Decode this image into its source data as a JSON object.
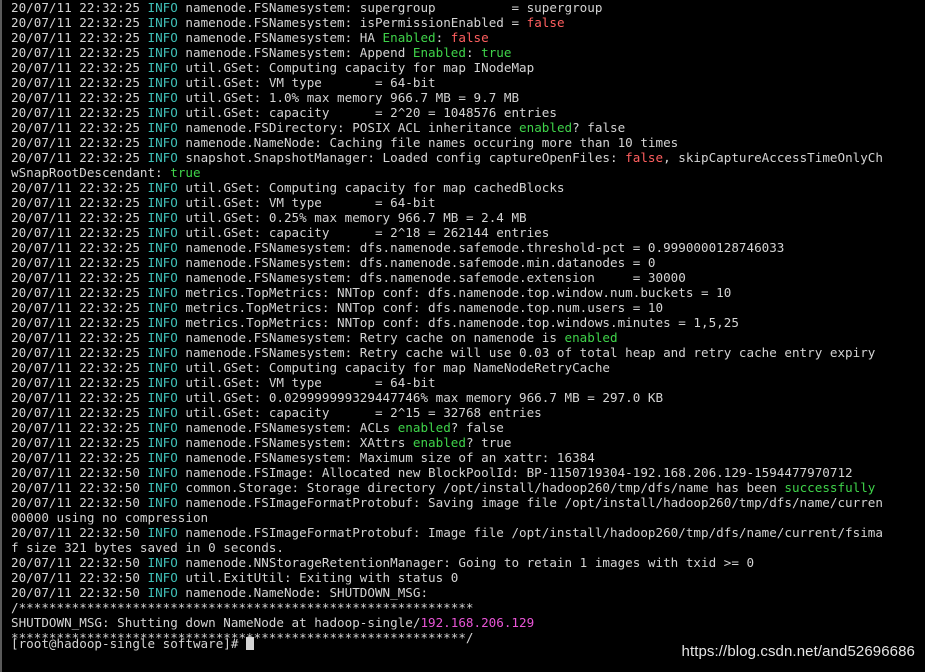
{
  "terminal": {
    "lines": [
      [
        {
          "t": "20/07/11 22:32:25 ",
          "c": "ts"
        },
        {
          "t": "INFO",
          "c": "info"
        },
        {
          "t": " namenode.FSNamesystem: supergroup          = supergroup",
          "c": "ts"
        }
      ],
      [
        {
          "t": "20/07/11 22:32:25 ",
          "c": "ts"
        },
        {
          "t": "INFO",
          "c": "info"
        },
        {
          "t": " namenode.FSNamesystem: isPermissionEnabled = ",
          "c": "ts"
        },
        {
          "t": "false",
          "c": "hl-red"
        }
      ],
      [
        {
          "t": "20/07/11 22:32:25 ",
          "c": "ts"
        },
        {
          "t": "INFO",
          "c": "info"
        },
        {
          "t": " namenode.FSNamesystem: HA ",
          "c": "ts"
        },
        {
          "t": "Enabled",
          "c": "hl-green"
        },
        {
          "t": ": ",
          "c": "ts"
        },
        {
          "t": "false",
          "c": "hl-red"
        }
      ],
      [
        {
          "t": "20/07/11 22:32:25 ",
          "c": "ts"
        },
        {
          "t": "INFO",
          "c": "info"
        },
        {
          "t": " namenode.FSNamesystem: Append ",
          "c": "ts"
        },
        {
          "t": "Enabled",
          "c": "hl-green"
        },
        {
          "t": ": ",
          "c": "ts"
        },
        {
          "t": "true",
          "c": "hl-green"
        }
      ],
      [
        {
          "t": "20/07/11 22:32:25 ",
          "c": "ts"
        },
        {
          "t": "INFO",
          "c": "info"
        },
        {
          "t": " util.GSet: Computing capacity for map INodeMap",
          "c": "ts"
        }
      ],
      [
        {
          "t": "20/07/11 22:32:25 ",
          "c": "ts"
        },
        {
          "t": "INFO",
          "c": "info"
        },
        {
          "t": " util.GSet: VM type       = 64-bit",
          "c": "ts"
        }
      ],
      [
        {
          "t": "20/07/11 22:32:25 ",
          "c": "ts"
        },
        {
          "t": "INFO",
          "c": "info"
        },
        {
          "t": " util.GSet: 1.0% max memory 966.7 MB = 9.7 MB",
          "c": "ts"
        }
      ],
      [
        {
          "t": "20/07/11 22:32:25 ",
          "c": "ts"
        },
        {
          "t": "INFO",
          "c": "info"
        },
        {
          "t": " util.GSet: capacity      = 2^20 = 1048576 entries",
          "c": "ts"
        }
      ],
      [
        {
          "t": "20/07/11 22:32:25 ",
          "c": "ts"
        },
        {
          "t": "INFO",
          "c": "info"
        },
        {
          "t": " namenode.FSDirectory: POSIX ACL inheritance ",
          "c": "ts"
        },
        {
          "t": "enabled",
          "c": "hl-green"
        },
        {
          "t": "? false",
          "c": "ts"
        }
      ],
      [
        {
          "t": "20/07/11 22:32:25 ",
          "c": "ts"
        },
        {
          "t": "INFO",
          "c": "info"
        },
        {
          "t": " namenode.NameNode: Caching file names occuring more than 10 times",
          "c": "ts"
        }
      ],
      [
        {
          "t": "20/07/11 22:32:25 ",
          "c": "ts"
        },
        {
          "t": "INFO",
          "c": "info"
        },
        {
          "t": " snapshot.SnapshotManager: Loaded config captureOpenFiles: ",
          "c": "ts"
        },
        {
          "t": "false",
          "c": "hl-red"
        },
        {
          "t": ", skipCaptureAccessTimeOnlyCh",
          "c": "ts"
        }
      ],
      [
        {
          "t": "wSnapRootDescendant: ",
          "c": "ts"
        },
        {
          "t": "true",
          "c": "hl-green"
        }
      ],
      [
        {
          "t": "20/07/11 22:32:25 ",
          "c": "ts"
        },
        {
          "t": "INFO",
          "c": "info"
        },
        {
          "t": " util.GSet: Computing capacity for map cachedBlocks",
          "c": "ts"
        }
      ],
      [
        {
          "t": "20/07/11 22:32:25 ",
          "c": "ts"
        },
        {
          "t": "INFO",
          "c": "info"
        },
        {
          "t": " util.GSet: VM type       = 64-bit",
          "c": "ts"
        }
      ],
      [
        {
          "t": "20/07/11 22:32:25 ",
          "c": "ts"
        },
        {
          "t": "INFO",
          "c": "info"
        },
        {
          "t": " util.GSet: 0.25% max memory 966.7 MB = 2.4 MB",
          "c": "ts"
        }
      ],
      [
        {
          "t": "20/07/11 22:32:25 ",
          "c": "ts"
        },
        {
          "t": "INFO",
          "c": "info"
        },
        {
          "t": " util.GSet: capacity      = 2^18 = 262144 entries",
          "c": "ts"
        }
      ],
      [
        {
          "t": "20/07/11 22:32:25 ",
          "c": "ts"
        },
        {
          "t": "INFO",
          "c": "info"
        },
        {
          "t": " namenode.FSNamesystem: dfs.namenode.safemode.threshold-pct = 0.9990000128746033",
          "c": "ts"
        }
      ],
      [
        {
          "t": "20/07/11 22:32:25 ",
          "c": "ts"
        },
        {
          "t": "INFO",
          "c": "info"
        },
        {
          "t": " namenode.FSNamesystem: dfs.namenode.safemode.min.datanodes = 0",
          "c": "ts"
        }
      ],
      [
        {
          "t": "20/07/11 22:32:25 ",
          "c": "ts"
        },
        {
          "t": "INFO",
          "c": "info"
        },
        {
          "t": " namenode.FSNamesystem: dfs.namenode.safemode.extension     = 30000",
          "c": "ts"
        }
      ],
      [
        {
          "t": "20/07/11 22:32:25 ",
          "c": "ts"
        },
        {
          "t": "INFO",
          "c": "info"
        },
        {
          "t": " metrics.TopMetrics: NNTop conf: dfs.namenode.top.window.num.buckets = 10",
          "c": "ts"
        }
      ],
      [
        {
          "t": "20/07/11 22:32:25 ",
          "c": "ts"
        },
        {
          "t": "INFO",
          "c": "info"
        },
        {
          "t": " metrics.TopMetrics: NNTop conf: dfs.namenode.top.num.users = 10",
          "c": "ts"
        }
      ],
      [
        {
          "t": "20/07/11 22:32:25 ",
          "c": "ts"
        },
        {
          "t": "INFO",
          "c": "info"
        },
        {
          "t": " metrics.TopMetrics: NNTop conf: dfs.namenode.top.windows.minutes = 1,5,25",
          "c": "ts"
        }
      ],
      [
        {
          "t": "20/07/11 22:32:25 ",
          "c": "ts"
        },
        {
          "t": "INFO",
          "c": "info"
        },
        {
          "t": " namenode.FSNamesystem: Retry cache on namenode is ",
          "c": "ts"
        },
        {
          "t": "enabled",
          "c": "hl-green"
        }
      ],
      [
        {
          "t": "20/07/11 22:32:25 ",
          "c": "ts"
        },
        {
          "t": "INFO",
          "c": "info"
        },
        {
          "t": " namenode.FSNamesystem: Retry cache will use 0.03 of total heap and retry cache entry expiry",
          "c": "ts"
        }
      ],
      [
        {
          "t": "20/07/11 22:32:25 ",
          "c": "ts"
        },
        {
          "t": "INFO",
          "c": "info"
        },
        {
          "t": " util.GSet: Computing capacity for map NameNodeRetryCache",
          "c": "ts"
        }
      ],
      [
        {
          "t": "20/07/11 22:32:25 ",
          "c": "ts"
        },
        {
          "t": "INFO",
          "c": "info"
        },
        {
          "t": " util.GSet: VM type       = 64-bit",
          "c": "ts"
        }
      ],
      [
        {
          "t": "20/07/11 22:32:25 ",
          "c": "ts"
        },
        {
          "t": "INFO",
          "c": "info"
        },
        {
          "t": " util.GSet: 0.029999999329447746% max memory 966.7 MB = 297.0 KB",
          "c": "ts"
        }
      ],
      [
        {
          "t": "20/07/11 22:32:25 ",
          "c": "ts"
        },
        {
          "t": "INFO",
          "c": "info"
        },
        {
          "t": " util.GSet: capacity      = 2^15 = 32768 entries",
          "c": "ts"
        }
      ],
      [
        {
          "t": "20/07/11 22:32:25 ",
          "c": "ts"
        },
        {
          "t": "INFO",
          "c": "info"
        },
        {
          "t": " namenode.FSNamesystem: ACLs ",
          "c": "ts"
        },
        {
          "t": "enabled",
          "c": "hl-green"
        },
        {
          "t": "? false",
          "c": "ts"
        }
      ],
      [
        {
          "t": "20/07/11 22:32:25 ",
          "c": "ts"
        },
        {
          "t": "INFO",
          "c": "info"
        },
        {
          "t": " namenode.FSNamesystem: XAttrs ",
          "c": "ts"
        },
        {
          "t": "enabled",
          "c": "hl-green"
        },
        {
          "t": "? true",
          "c": "ts"
        }
      ],
      [
        {
          "t": "20/07/11 22:32:25 ",
          "c": "ts"
        },
        {
          "t": "INFO",
          "c": "info"
        },
        {
          "t": " namenode.FSNamesystem: Maximum size of an xattr: 16384",
          "c": "ts"
        }
      ],
      [
        {
          "t": "20/07/11 22:32:50 ",
          "c": "ts"
        },
        {
          "t": "INFO",
          "c": "info"
        },
        {
          "t": " namenode.FSImage: Allocated new BlockPoolId: BP-1150719304-192.168.206.129-1594477970712",
          "c": "ts"
        }
      ],
      [
        {
          "t": "20/07/11 22:32:50 ",
          "c": "ts"
        },
        {
          "t": "INFO",
          "c": "info"
        },
        {
          "t": " common.Storage: Storage directory /opt/install/hadoop260/tmp/dfs/name has been ",
          "c": "ts"
        },
        {
          "t": "successfully",
          "c": "hl-green"
        }
      ],
      [
        {
          "t": "20/07/11 22:32:50 ",
          "c": "ts"
        },
        {
          "t": "INFO",
          "c": "info"
        },
        {
          "t": " namenode.FSImageFormatProtobuf: Saving image file /opt/install/hadoop260/tmp/dfs/name/curren",
          "c": "ts"
        }
      ],
      [
        {
          "t": "00000 using no compression",
          "c": "ts"
        }
      ],
      [
        {
          "t": "20/07/11 22:32:50 ",
          "c": "ts"
        },
        {
          "t": "INFO",
          "c": "info"
        },
        {
          "t": " namenode.FSImageFormatProtobuf: Image file /opt/install/hadoop260/tmp/dfs/name/current/fsima",
          "c": "ts"
        }
      ],
      [
        {
          "t": "f size 321 bytes saved in 0 seconds.",
          "c": "ts"
        }
      ],
      [
        {
          "t": "20/07/11 22:32:50 ",
          "c": "ts"
        },
        {
          "t": "INFO",
          "c": "info"
        },
        {
          "t": " namenode.NNStorageRetentionManager: Going to retain 1 images with txid >= 0",
          "c": "ts"
        }
      ],
      [
        {
          "t": "20/07/11 22:32:50 ",
          "c": "ts"
        },
        {
          "t": "INFO",
          "c": "info"
        },
        {
          "t": " util.ExitUtil: Exiting with status 0",
          "c": "ts"
        }
      ],
      [
        {
          "t": "20/07/11 22:32:50 ",
          "c": "ts"
        },
        {
          "t": "INFO",
          "c": "info"
        },
        {
          "t": " namenode.NameNode: SHUTDOWN_MSG:",
          "c": "ts"
        }
      ],
      [
        {
          "t": "/************************************************************",
          "c": "star"
        }
      ],
      [
        {
          "t": "SHUTDOWN_MSG: Shutting down NameNode at hadoop-single/",
          "c": "ts"
        },
        {
          "t": "192.168.206.129",
          "c": "hl-magenta"
        }
      ],
      [
        {
          "t": "************************************************************/",
          "c": "star"
        }
      ]
    ],
    "prompt": "[root@hadoop-single software]# "
  },
  "watermark": "https://blog.csdn.net/and52696686"
}
